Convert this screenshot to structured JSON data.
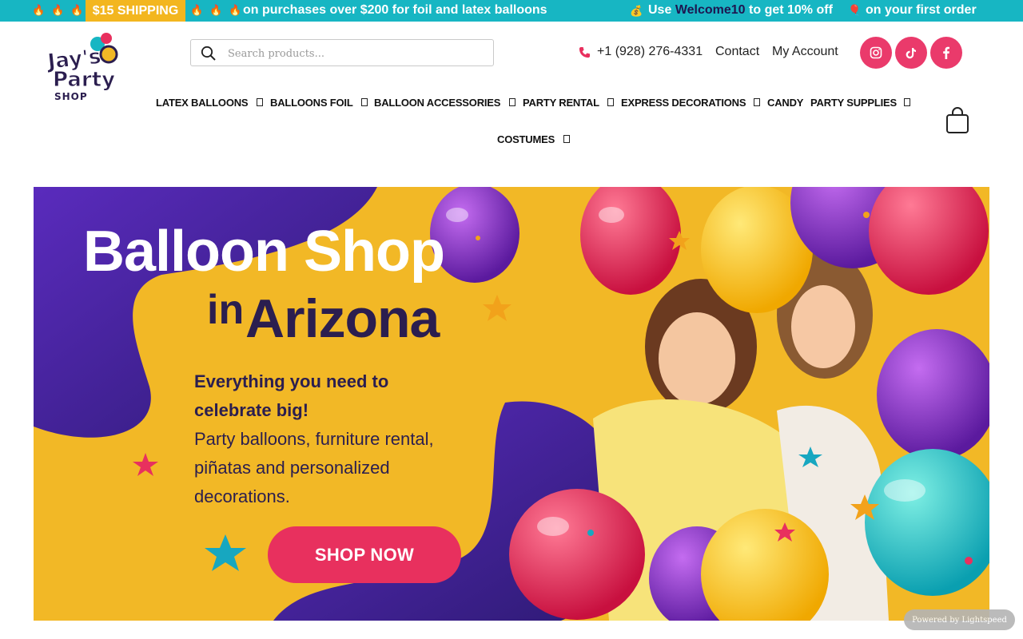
{
  "promo": {
    "shipping_tag": "$15 SHIPPING",
    "shipping_message": "on purchases over $200 for foil and latex balloons",
    "coupon_prefix": "Use",
    "coupon_code": "Welcome10",
    "coupon_suffix": "to get 10% off",
    "first_order": "on your first order",
    "flame_glyph": "🔥",
    "money_glyph": "💰",
    "balloon_glyph": "🎈"
  },
  "logo": {
    "line1": "Jay's",
    "line2": "Party",
    "line3": "SHOP"
  },
  "search": {
    "placeholder": "Search products..."
  },
  "header": {
    "phone": "+1 (928) 276-4331",
    "contact": "Contact",
    "account": "My Account"
  },
  "social": {
    "instagram": "instagram-icon",
    "tiktok": "tiktok-icon",
    "facebook": "facebook-icon"
  },
  "nav": {
    "latex": "LATEX BALLOONS",
    "foil": "BALLOONS FOIL",
    "accessories": "BALLOON ACCESSORIES",
    "rental": "PARTY RENTAL",
    "express": "EXPRESS DECORATIONS",
    "candy": "CANDY",
    "supplies": "PARTY SUPPLIES",
    "costumes": "COSTUMES"
  },
  "hero": {
    "title_line1": "Balloon Shop",
    "title_in": "in",
    "title_place": "Arizona",
    "lead": "Everything you need to celebrate big!",
    "description": "Party balloons, furniture rental, piñatas and personalized decorations.",
    "cta": "SHOP NOW"
  },
  "powered_by": "Powered by Lightspeed",
  "colors": {
    "teal": "#17b6c3",
    "yellow": "#f2b826",
    "pink": "#e8305e",
    "navy": "#2b1e4f",
    "purple": "#4a2aa6"
  }
}
